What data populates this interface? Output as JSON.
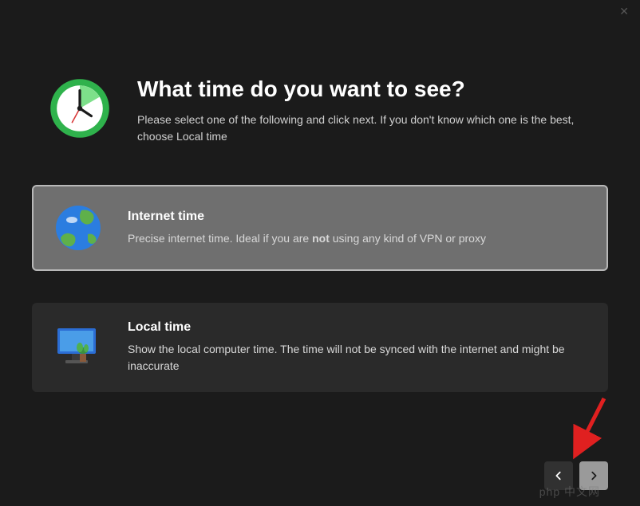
{
  "window": {
    "close_label": "✕"
  },
  "header": {
    "title": "What time do you want to see?",
    "subtitle": "Please select one of the following and click next. If you don't know which one is the best, choose Local time"
  },
  "options": {
    "internet": {
      "title": "Internet time",
      "desc_prefix": "Precise internet time. Ideal if you are ",
      "desc_emphasis": "not",
      "desc_suffix": " using any kind of VPN or proxy"
    },
    "local": {
      "title": "Local time",
      "desc": "Show the local computer time. The time will not be synced with the internet and might be inaccurate"
    }
  },
  "nav": {
    "back": "‹",
    "next": "›"
  },
  "watermark": "php 中文网"
}
